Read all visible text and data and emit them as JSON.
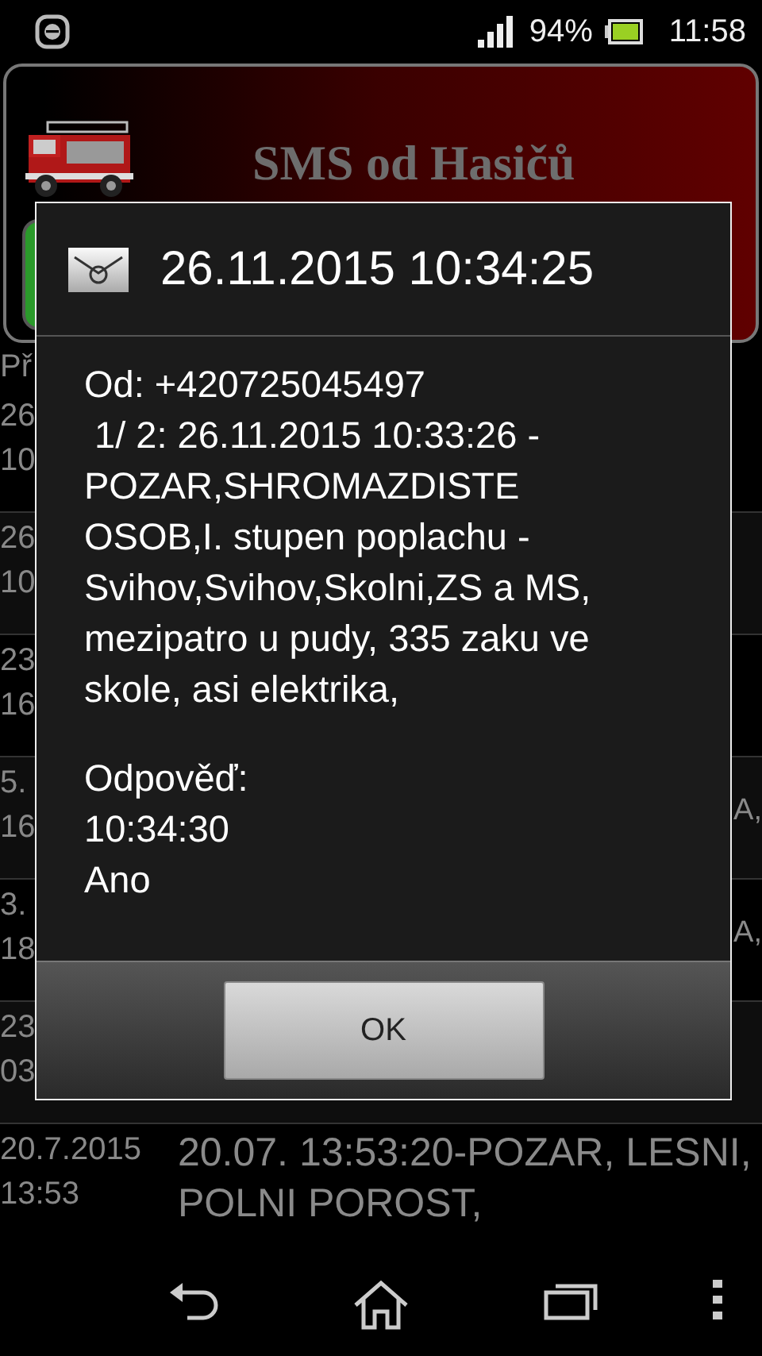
{
  "status_bar": {
    "battery": "94%",
    "time": "11:58"
  },
  "header": {
    "title": "SMS od Hasičů"
  },
  "list": {
    "column_heading": "Př",
    "rows": [
      {
        "date": "26",
        "time": "10"
      },
      {
        "date": "26",
        "time": "10"
      },
      {
        "date": "23",
        "time": "16"
      },
      {
        "date": "5.",
        "time": "16",
        "text": "A,"
      },
      {
        "date": "3.",
        "time": "18",
        "text": "A,"
      },
      {
        "date": "23",
        "time": "03"
      },
      {
        "date": "20.7.2015",
        "time": "13:53",
        "text": "20.07. 13:53:20-POZAR, LESNI, POLNI POROST,"
      }
    ]
  },
  "dialog": {
    "title": "26.11.2015 10:34:25",
    "sender": "Od: +420725045497",
    "message": " 1/ 2: 26.11.2015 10:33:26 - POZAR,SHROMAZDISTE OSOB,I. stupen poplachu - Svihov,Svihov,Skolni,ZS a MS, mezipatro u pudy, 335 zaku ve skole, asi elektrika,",
    "reply_label": "Odpověď:",
    "reply_time": "10:34:30",
    "reply_text": "Ano",
    "button": "OK"
  }
}
